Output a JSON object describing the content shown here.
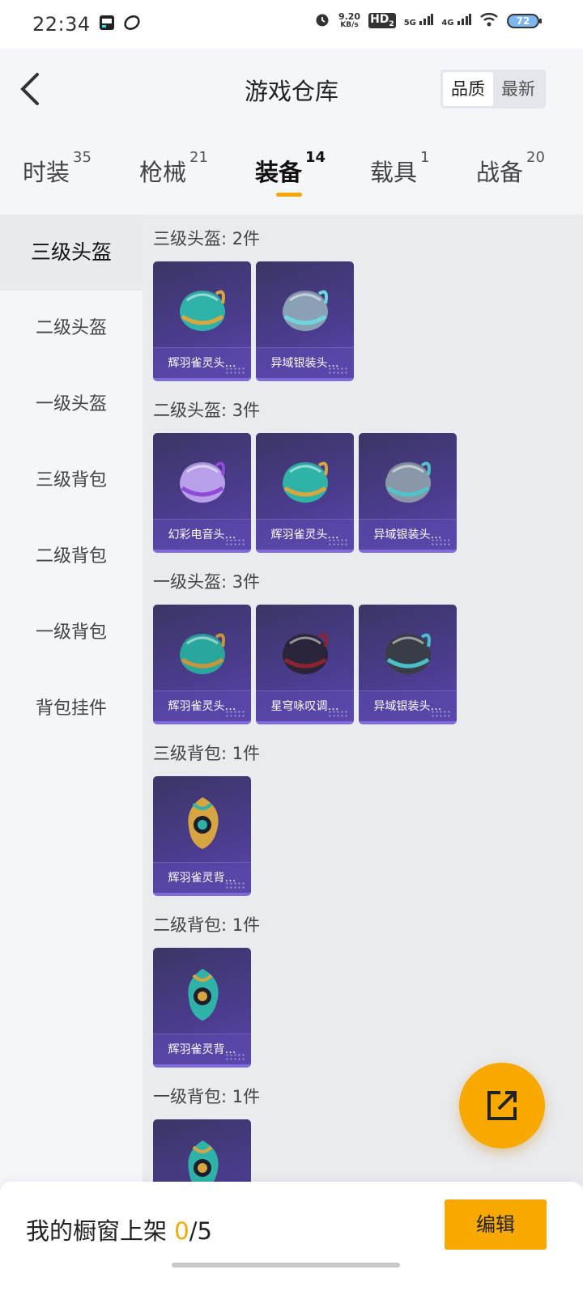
{
  "status_bar": {
    "time": "22:34",
    "speed_value": "9.20",
    "speed_unit": "KB/s",
    "hd": "HD",
    "sim2": "2",
    "net1": "5G",
    "net2": "4G",
    "battery": "72",
    "icons": [
      "notification-app-icon",
      "cloud-icon",
      "alarm-icon",
      "signal-icon",
      "wifi-icon",
      "battery-icon"
    ]
  },
  "header": {
    "title": "游戏仓库",
    "sort_options": [
      {
        "label": "品质",
        "active": true
      },
      {
        "label": "最新",
        "active": false
      }
    ]
  },
  "tabs": [
    {
      "label": "时装",
      "count": "35",
      "active": false
    },
    {
      "label": "枪械",
      "count": "21",
      "active": false
    },
    {
      "label": "装备",
      "count": "14",
      "active": true
    },
    {
      "label": "载具",
      "count": "1",
      "active": false
    },
    {
      "label": "战备",
      "count": "20",
      "active": false
    }
  ],
  "sidebar": {
    "items": [
      {
        "label": "三级头盔",
        "active": true
      },
      {
        "label": "二级头盔",
        "active": false
      },
      {
        "label": "一级头盔",
        "active": false
      },
      {
        "label": "三级背包",
        "active": false
      },
      {
        "label": "二级背包",
        "active": false
      },
      {
        "label": "一级背包",
        "active": false
      },
      {
        "label": "背包挂件",
        "active": false
      }
    ]
  },
  "sections": [
    {
      "title": "三级头盔: 2件",
      "items": [
        {
          "name": "辉羽雀灵头…",
          "art": "helmet",
          "color": "#2fb3a8",
          "accent": "#d9a640"
        },
        {
          "name": "异域银装头…",
          "art": "helmet",
          "color": "#8aa0b4",
          "accent": "#6fd6e0"
        }
      ]
    },
    {
      "title": "二级头盔: 3件",
      "items": [
        {
          "name": "幻彩电音头…",
          "art": "helmet",
          "color": "#b7a0e8",
          "accent": "#8f4bd8"
        },
        {
          "name": "辉羽雀灵头…",
          "art": "helmet",
          "color": "#2fb3a8",
          "accent": "#d9a640"
        },
        {
          "name": "异域银装头…",
          "art": "helmet",
          "color": "#8a97a8",
          "accent": "#4fc3c8"
        }
      ]
    },
    {
      "title": "一级头盔: 3件",
      "items": [
        {
          "name": "辉羽雀灵头…",
          "art": "helmet",
          "color": "#2aa79c",
          "accent": "#c9953a"
        },
        {
          "name": "星穹咏叹调…",
          "art": "helmet",
          "color": "#2a2438",
          "accent": "#8b2430"
        },
        {
          "name": "异域银装头…",
          "art": "helmet",
          "color": "#3a3d46",
          "accent": "#49c0c8"
        }
      ]
    },
    {
      "title": "三级背包: 1件",
      "items": [
        {
          "name": "辉羽雀灵背…",
          "art": "backpack",
          "color": "#d6a441",
          "accent": "#2fb3a8"
        }
      ]
    },
    {
      "title": "二级背包: 1件",
      "items": [
        {
          "name": "辉羽雀灵背…",
          "art": "backpack",
          "color": "#2fb3a8",
          "accent": "#d6a441"
        }
      ]
    },
    {
      "title": "一级背包: 1件",
      "items": [
        {
          "name": "",
          "art": "backpack",
          "color": "#2fb3a8",
          "accent": "#d6a441"
        }
      ]
    }
  ],
  "bottom": {
    "showcase_label": "我的橱窗上架",
    "showcase_count": "0",
    "showcase_total": "/5",
    "edit_label": "编辑"
  },
  "colors": {
    "accent": "#f8a900",
    "card_bg": "#4c3c8f"
  }
}
